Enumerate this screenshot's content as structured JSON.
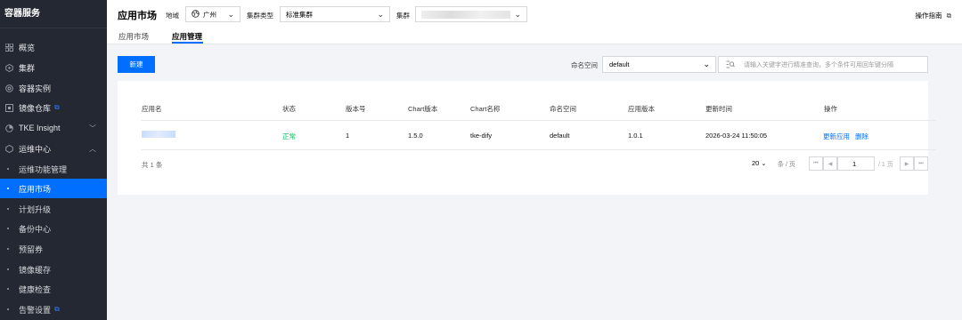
{
  "sidebar": {
    "title": "容器服务",
    "items": [
      {
        "label": "概览",
        "icon": "grid-icon"
      },
      {
        "label": "集群",
        "icon": "cluster-icon"
      },
      {
        "label": "容器实例",
        "icon": "instance-icon"
      },
      {
        "label": "镜像仓库",
        "icon": "registry-icon"
      },
      {
        "label": "TKE Insight",
        "icon": "insight-icon"
      },
      {
        "label": "运维中心",
        "icon": "ops-icon"
      }
    ],
    "sub_items": [
      {
        "label": "运维功能管理"
      },
      {
        "label": "应用市场"
      },
      {
        "label": "计划升级"
      },
      {
        "label": "备份中心"
      },
      {
        "label": "预留券"
      },
      {
        "label": "镜像缓存"
      },
      {
        "label": "健康检查"
      },
      {
        "label": "告警设置"
      }
    ]
  },
  "header": {
    "title": "应用市场",
    "region_label": "地域",
    "region_value": "广州",
    "cluster_type_label": "集群类型",
    "cluster_type_value": "标准集群",
    "cluster_label": "集群",
    "guide": "操作指南",
    "tabs": [
      "应用市场",
      "应用管理"
    ]
  },
  "toolbar": {
    "new_button": "新建",
    "namespace_label": "命名空间",
    "namespace_value": "default",
    "search_placeholder": "请输入关键字进行精准查询，多个条件可用回车键分隔"
  },
  "table": {
    "headers": [
      "应用名",
      "状态",
      "版本号",
      "Chart版本",
      "Chart名称",
      "命名空间",
      "应用版本",
      "更新时间",
      "操作"
    ],
    "rows": [
      {
        "status": "正常",
        "revision": "1",
        "chart_version": "1.5.0",
        "chart_name": "tke-dify",
        "namespace": "default",
        "app_version": "1.0.1",
        "updated": "2026-03-24 11:50:05",
        "action_update": "更新应用",
        "action_delete": "删除"
      }
    ]
  },
  "pagination": {
    "total": "共 1 条",
    "page_size": "20",
    "page_size_unit": "条 / 页",
    "current_page": "1",
    "total_pages": "/ 1 页"
  },
  "colors": {
    "primary": "#006eff",
    "sidebar_bg": "#242832",
    "success": "#0abf5b"
  }
}
